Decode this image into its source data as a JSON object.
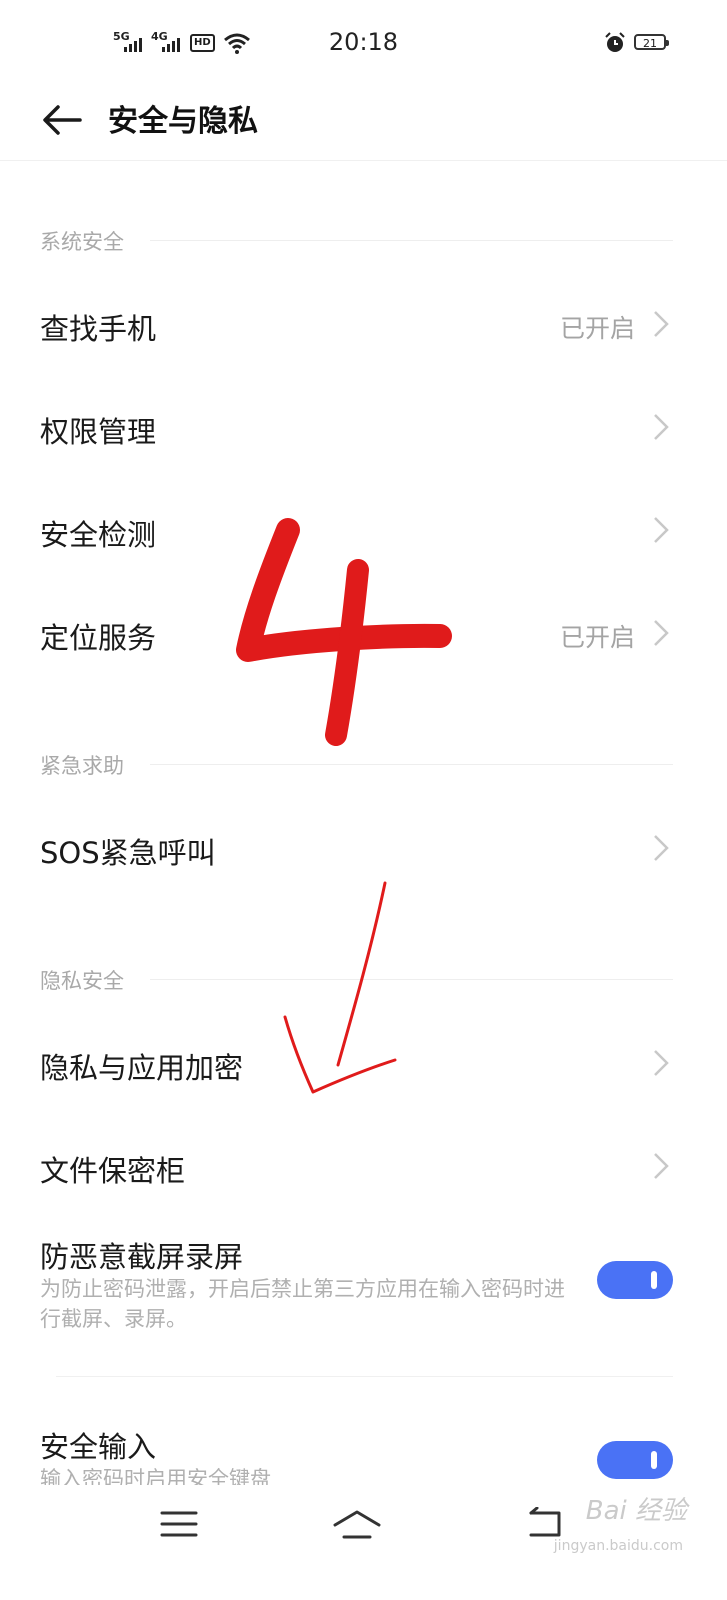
{
  "status_bar": {
    "signal_1": "5G",
    "signal_2": "4G",
    "hd": "HD",
    "time": "20:18",
    "battery": "21",
    "icons": [
      "wifi-icon",
      "alarm-icon",
      "battery-icon"
    ]
  },
  "header": {
    "title": "安全与隐私",
    "back_icon": "back-arrow-icon"
  },
  "sections": {
    "system": {
      "label": "系统安全",
      "items": [
        {
          "label": "查找手机",
          "value": "已开启"
        },
        {
          "label": "权限管理",
          "value": ""
        },
        {
          "label": "安全检测",
          "value": ""
        },
        {
          "label": "定位服务",
          "value": "已开启"
        }
      ]
    },
    "emergency": {
      "label": "紧急求助",
      "items": [
        {
          "label": "SOS紧急呼叫",
          "value": ""
        }
      ]
    },
    "privacy": {
      "label": "隐私安全",
      "items": [
        {
          "label": "隐私与应用加密",
          "value": ""
        },
        {
          "label": "文件保密柜",
          "value": ""
        }
      ],
      "toggles": [
        {
          "label": "防恶意截屏录屏",
          "description": "为防止密码泄露，开启后禁止第三方应用在输入密码时进行截屏、录屏。",
          "on": true
        },
        {
          "label": "安全输入",
          "description": "输入密码时启用安全键盘",
          "on": true
        }
      ]
    }
  },
  "annotation": {
    "number": "4",
    "color": "#e01b1b"
  },
  "nav_icons": [
    "menu-icon",
    "home-icon",
    "back-nav-icon"
  ],
  "watermark": {
    "text": "Bai 经验",
    "sub": "jingyan.baidu.com"
  },
  "colors": {
    "accent": "#4a72f5",
    "annotation": "#e01b1b"
  }
}
